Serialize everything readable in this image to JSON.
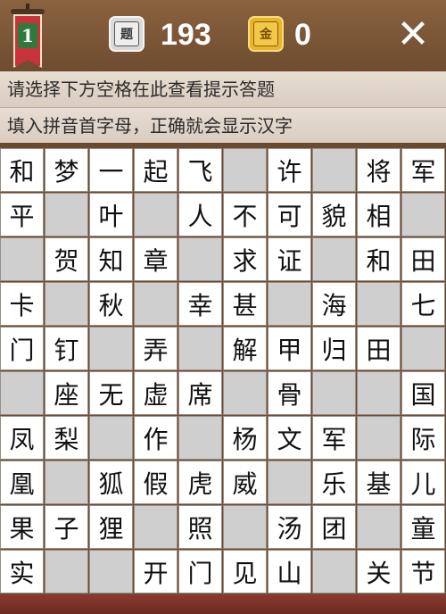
{
  "header": {
    "level": "1",
    "question_tile_glyph": "题",
    "question_count": "193",
    "gold_tile_glyph": "金",
    "gold_count": "0",
    "close_glyph": "✕"
  },
  "hints": {
    "line1": "请选择下方空格在此查看提示答题",
    "line2": "填入拼音首字母，正确就会显示汉字"
  },
  "grid": {
    "rows": [
      [
        "和",
        "梦",
        "一",
        "起",
        "飞",
        "",
        "许",
        "",
        "将",
        "军"
      ],
      [
        "平",
        "",
        "叶",
        "",
        "人",
        "不",
        "可",
        "貌",
        "相",
        ""
      ],
      [
        "",
        "贺",
        "知",
        "章",
        "",
        "求",
        "证",
        "",
        "和",
        "田"
      ],
      [
        "卡",
        "",
        "秋",
        "",
        "幸",
        "甚",
        "",
        "海",
        "",
        "七"
      ],
      [
        "门",
        "钉",
        "",
        "弄",
        "",
        "解",
        "甲",
        "归",
        "田",
        ""
      ],
      [
        "",
        "座",
        "无",
        "虚",
        "席",
        "",
        "骨",
        "",
        "",
        "国"
      ],
      [
        "凤",
        "梨",
        "",
        "作",
        "",
        "杨",
        "文",
        "军",
        "",
        "际"
      ],
      [
        "凰",
        "",
        "狐",
        "假",
        "虎",
        "威",
        "",
        "乐",
        "基",
        "儿"
      ],
      [
        "果",
        "子",
        "狸",
        "",
        "照",
        "",
        "汤",
        "团",
        "",
        "童"
      ],
      [
        "实",
        "",
        "",
        "开",
        "门",
        "见",
        "山",
        "",
        "关",
        "节"
      ]
    ]
  }
}
